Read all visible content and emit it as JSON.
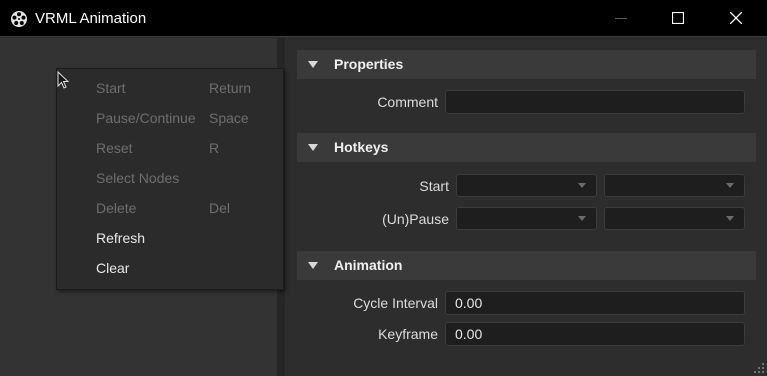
{
  "window": {
    "title": "VRML Animation",
    "icons": {
      "app": "film-reel-icon",
      "minimize": "minimize-icon",
      "maximize": "maximize-icon",
      "close": "close-icon"
    }
  },
  "context_menu": {
    "items": [
      {
        "label": "Start",
        "shortcut": "Return",
        "enabled": false
      },
      {
        "label": "Pause/Continue",
        "shortcut": "Space",
        "enabled": false
      },
      {
        "label": "Reset",
        "shortcut": "R",
        "enabled": false
      },
      {
        "label": "Select Nodes",
        "shortcut": "",
        "enabled": false
      },
      {
        "label": "Delete",
        "shortcut": "Del",
        "enabled": false
      },
      {
        "label": "Refresh",
        "shortcut": "",
        "enabled": true
      },
      {
        "label": "Clear",
        "shortcut": "",
        "enabled": true
      }
    ]
  },
  "properties": {
    "title": "Properties",
    "comment_label": "Comment",
    "comment_value": ""
  },
  "hotkeys": {
    "title": "Hotkeys",
    "start_label": "Start",
    "start_key1": "",
    "start_key2": "",
    "pause_label": "(Un)Pause",
    "pause_key1": "",
    "pause_key2": ""
  },
  "animation": {
    "title": "Animation",
    "cycle_interval_label": "Cycle Interval",
    "cycle_interval_value": "0.00",
    "keyframe_label": "Keyframe",
    "keyframe_value": "0.00"
  },
  "colors": {
    "background": "#2d2d2d",
    "titlebar": "#000000",
    "section_header": "#3a3a3a",
    "input_bg": "#1e1e1e",
    "disabled_text": "#6e6e6e"
  }
}
